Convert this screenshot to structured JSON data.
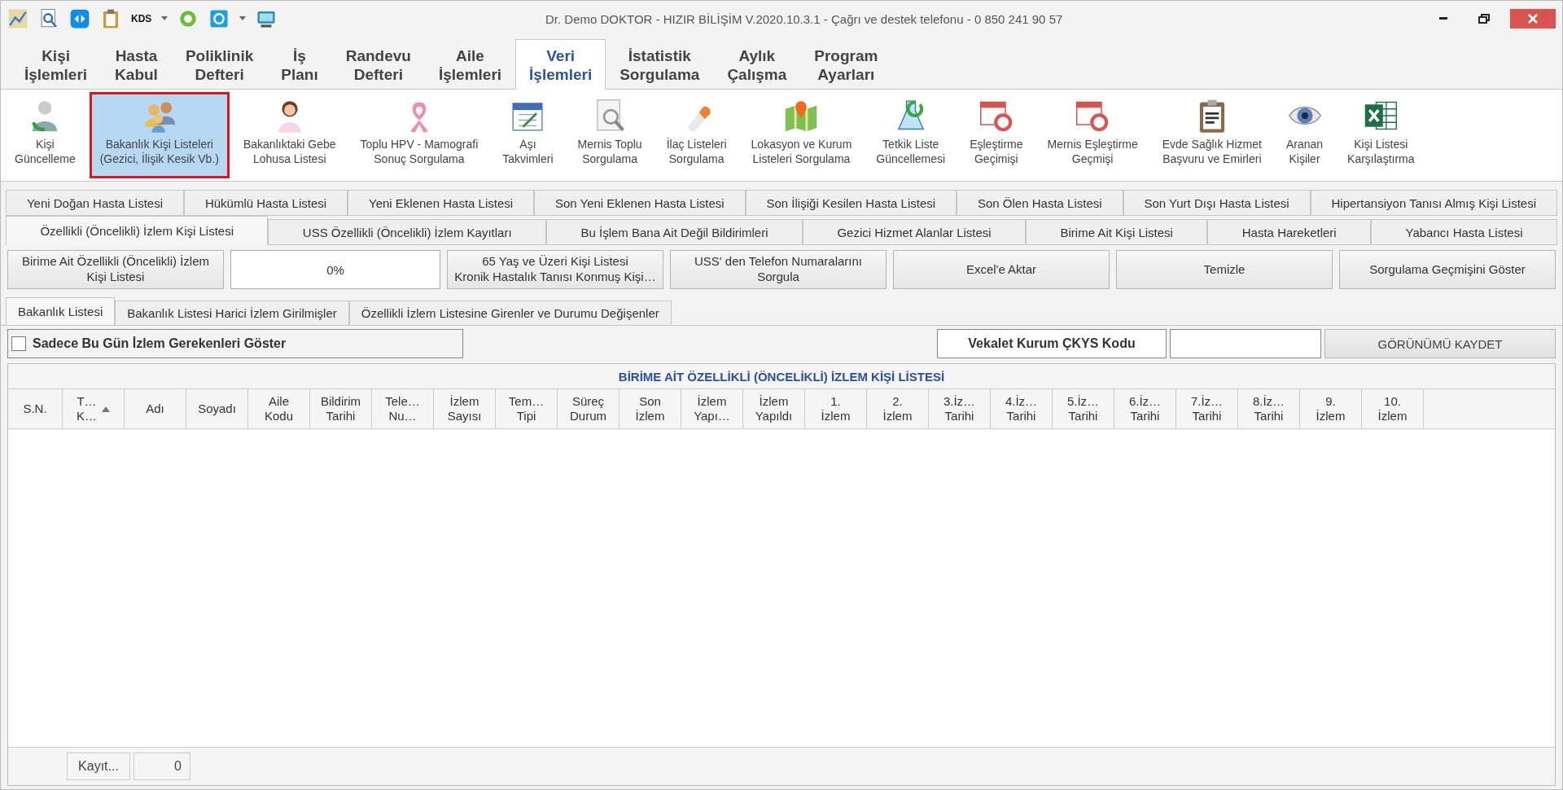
{
  "window": {
    "title": "Dr. Demo DOKTOR - HIZIR BİLİŞİM V.2020.10.3.1 - Çağrı ve destek telefonu - 0 850 241 90 57"
  },
  "quick_access": [
    {
      "kind": "icon"
    },
    {
      "kind": "icon"
    },
    {
      "kind": "icon"
    },
    {
      "kind": "icon"
    },
    {
      "kind": "text",
      "label": "KDS"
    },
    {
      "kind": "icon"
    },
    {
      "kind": "menu-icon"
    },
    {
      "kind": "icon"
    }
  ],
  "main_tabs": [
    {
      "label": "Kişi\nİşlemleri",
      "selected": false
    },
    {
      "label": "Hasta\nKabul",
      "selected": false
    },
    {
      "label": "Poliklinik\nDefteri",
      "selected": false
    },
    {
      "label": "İş\nPlanı",
      "selected": false
    },
    {
      "label": "Randevu\nDefteri",
      "selected": false
    },
    {
      "label": "Aile\nİşlemleri",
      "selected": false
    },
    {
      "label": "Veri\nİşlemleri",
      "selected": true
    },
    {
      "label": "İstatistik\nSorgulama",
      "selected": false
    },
    {
      "label": "Aylık\nÇalışma",
      "selected": false
    },
    {
      "label": "Program\nAyarları",
      "selected": false
    }
  ],
  "ribbon": [
    {
      "label": "Kişi\nGüncelleme",
      "selected": false
    },
    {
      "label": "Bakanlık Kişi Listeleri\n(Gezici, İlişik Kesik Vb.)",
      "selected": true
    },
    {
      "label": "Bakanlıktaki Gebe\nLohusa Listesi",
      "selected": false
    },
    {
      "label": "Toplu HPV - Mamografi\nSonuç Sorgulama",
      "selected": false
    },
    {
      "label": "Aşı\nTakvimleri",
      "selected": false
    },
    {
      "label": "Mernis Toplu\nSorgulama",
      "selected": false
    },
    {
      "label": "İlaç Listeleri\nSorgulama",
      "selected": false
    },
    {
      "label": "Lokasyon ve Kurum\nListeleri Sorgulama",
      "selected": false
    },
    {
      "label": "Tetkik Liste\nGüncellemesi",
      "selected": false
    },
    {
      "label": "Eşleştirme\nGeçimişi",
      "selected": false
    },
    {
      "label": "Mernis Eşleştirme\nGeçmişi",
      "selected": false
    },
    {
      "label": "Evde Sağlık Hizmet\nBaşvuru ve Emirleri",
      "selected": false
    },
    {
      "label": "Aranan\nKişiler",
      "selected": false
    },
    {
      "label": "Kişi Listesi\nKarşılaştırma",
      "selected": false
    }
  ],
  "list_tabs": [
    [
      {
        "label": "Yeni Doğan Hasta Listesi",
        "selected": false
      },
      {
        "label": "Hükümlü Hasta Listesi",
        "selected": false
      },
      {
        "label": "Yeni Eklenen Hasta Listesi",
        "selected": false
      },
      {
        "label": "Son Yeni Eklenen Hasta Listesi",
        "selected": false
      },
      {
        "label": "Son İlişiği Kesilen Hasta Listesi",
        "selected": false
      },
      {
        "label": "Son Ölen Hasta Listesi",
        "selected": false
      },
      {
        "label": "Son Yurt Dışı Hasta Listesi",
        "selected": false
      },
      {
        "label": "Hipertansiyon Tanısı Almış Kişi Listesi",
        "selected": false
      }
    ],
    [
      {
        "label": "Özellikli (Öncelikli) İzlem Kişi Listesi",
        "selected": true
      },
      {
        "label": "USS Özellikli (Öncelikli) İzlem Kayıtları",
        "selected": false
      },
      {
        "label": "Bu İşlem Bana Ait Değil Bildirimleri",
        "selected": false
      },
      {
        "label": "Gezici Hizmet Alanlar Listesi",
        "selected": false
      },
      {
        "label": "Birime Ait Kişi Listesi",
        "selected": false
      },
      {
        "label": "Hasta Hareketleri",
        "selected": false
      },
      {
        "label": "Yabancı Hasta Listesi",
        "selected": false
      }
    ]
  ],
  "actions": [
    {
      "kind": "button",
      "label": "Birime Ait Özellikli (Öncelikli) İzlem\nKişi Listesi"
    },
    {
      "kind": "progress",
      "label": "0%",
      "level": 0
    },
    {
      "kind": "button",
      "label": "65 Yaş ve Üzeri Kişi Listesi\nKronik Hastalık Tanısı Konmuş Kişi…"
    },
    {
      "kind": "button",
      "label": "USS' den Telefon Numaralarını\nSorgula"
    },
    {
      "kind": "button",
      "label": "Excel'e Aktar"
    },
    {
      "kind": "button",
      "label": "Temizle"
    },
    {
      "kind": "button",
      "label": "Sorgulama Geçmişini Göster"
    }
  ],
  "sub_tabs": [
    {
      "label": "Bakanlık Listesi",
      "selected": true
    },
    {
      "label": "Bakanlık Listesi Harici İzlem Girilmişler",
      "selected": false
    },
    {
      "label": "Özellikli İzlem Listesine Girenler ve Durumu Değişenler",
      "selected": false
    }
  ],
  "filter": {
    "label": "Sadece Bu Gün İzlem Gerekenleri Göster",
    "checked": false
  },
  "vekalet": {
    "label": "Vekalet Kurum ÇKYS Kodu",
    "save_button": "GÖRÜNÜMÜ KAYDET"
  },
  "table": {
    "title": "BİRİME AİT ÖZELLİKLİ (ÖNCELİKLİ) İZLEM KİŞİ LİSTESİ",
    "columns": [
      {
        "label": "S.N.",
        "sorted": false
      },
      {
        "label": "T…\nK…",
        "sorted": true
      },
      {
        "label": "Adı",
        "sorted": false
      },
      {
        "label": "Soyadı",
        "sorted": false
      },
      {
        "label": "Aile\nKodu",
        "sorted": false
      },
      {
        "label": "Bildirim\nTarihi",
        "sorted": false
      },
      {
        "label": "Tele…\nNu…",
        "sorted": false
      },
      {
        "label": "İzlem\nSayısı",
        "sorted": false
      },
      {
        "label": "Tem…\nTipi",
        "sorted": false
      },
      {
        "label": "Süreç\nDurum",
        "sorted": false
      },
      {
        "label": "Son\nİzlem",
        "sorted": false
      },
      {
        "label": "İzlem\nYapı…",
        "sorted": false
      },
      {
        "label": "İzlem\nYapıldı",
        "sorted": false
      },
      {
        "label": "1.\nİzlem",
        "sorted": false
      },
      {
        "label": "2.\nİzlem",
        "sorted": false
      },
      {
        "label": "3.İz…\nTarihi",
        "sorted": false
      },
      {
        "label": "4.İz…\nTarihi",
        "sorted": false
      },
      {
        "label": "5.İz…\nTarihi",
        "sorted": false
      },
      {
        "label": "6.İz…\nTarihi",
        "sorted": false
      },
      {
        "label": "7.İz…\nTarihi",
        "sorted": false
      },
      {
        "label": "8.İz…\nTarihi",
        "sorted": false
      },
      {
        "label": "9.\nİzlem",
        "sorted": false
      },
      {
        "label": "10.\nİzlem",
        "sorted": false
      }
    ]
  },
  "footer": {
    "record_label": "Kayıt...",
    "count": "0"
  }
}
